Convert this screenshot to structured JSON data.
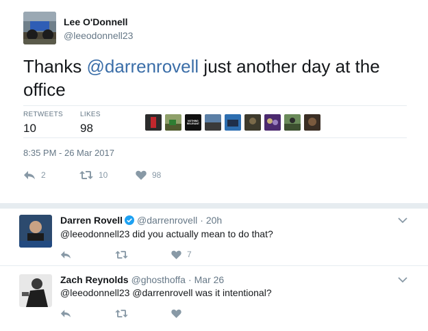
{
  "tweet": {
    "author_name": "Lee O'Donnell",
    "author_handle": "@leeodonnell23",
    "text_prefix": "Thanks ",
    "text_mention": "@darrenrovell",
    "text_suffix": " just another day at the office",
    "retweets_label": "RETWEETS",
    "retweets_value": "10",
    "likes_label": "LIKES",
    "likes_value": "98",
    "timestamp": "8:35 PM - 26 Mar 2017",
    "actions": {
      "reply_count": "2",
      "retweet_count": "10",
      "like_count": "98"
    },
    "liker_avatar_text": "NOTHING RELEVANT"
  },
  "replies": [
    {
      "name": "Darren Rovell",
      "handle": "@darrenrovell",
      "separator": "·",
      "time": "20h",
      "verified": true,
      "text": "@leeodonnell23 did you actually mean to do that?",
      "like_count": "7"
    },
    {
      "name": "Zach Reynolds",
      "handle": "@ghosthoffa",
      "separator": "·",
      "time": "Mar 26",
      "verified": false,
      "text": "@leeodonnell23 @darrenrovell was it intentional?",
      "like_count": ""
    }
  ],
  "colors": {
    "text": "#14171a",
    "muted": "#657786",
    "icon": "#8899a6",
    "mention": "#3b6ea8",
    "divider": "#e6ecf0",
    "verified": "#1da1f2"
  },
  "icons": [
    "reply-icon",
    "retweet-icon",
    "heart-icon",
    "chevron-down-icon",
    "verified-badge-icon"
  ]
}
